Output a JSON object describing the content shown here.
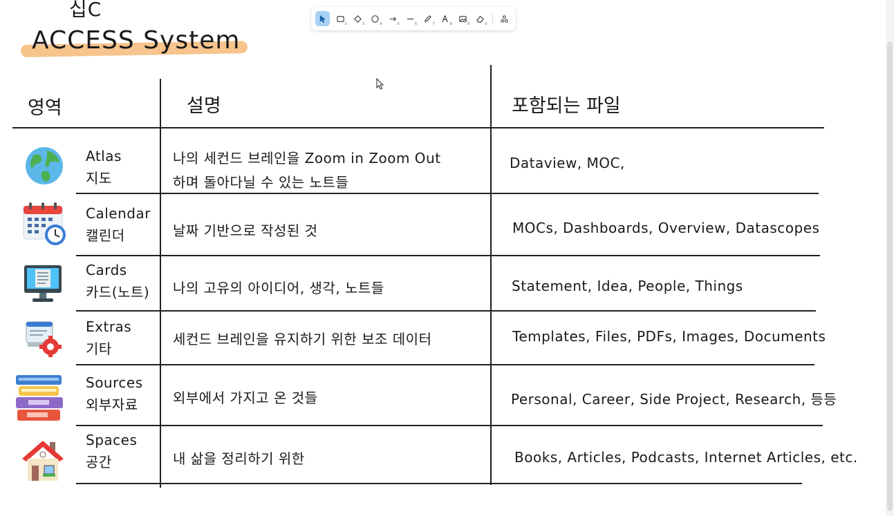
{
  "title": {
    "top": "십C",
    "main": "ACCESS System"
  },
  "toolbar": {
    "tools": [
      {
        "name": "select-tool",
        "num": ""
      },
      {
        "name": "rectangle-tool",
        "num": "2"
      },
      {
        "name": "diamond-tool",
        "num": "3"
      },
      {
        "name": "ellipse-tool",
        "num": "4"
      },
      {
        "name": "arrow-tool",
        "num": "5"
      },
      {
        "name": "line-tool",
        "num": "6"
      },
      {
        "name": "pencil-tool",
        "num": "7"
      },
      {
        "name": "text-tool",
        "num": "8"
      },
      {
        "name": "image-tool",
        "num": "9"
      },
      {
        "name": "eraser-tool",
        "num": "0"
      },
      {
        "name": "more-tools",
        "num": ""
      }
    ]
  },
  "table": {
    "headers": {
      "area": "영역",
      "description": "설명",
      "files": "포함되는 파일"
    },
    "rows": [
      {
        "icon": "globe-icon",
        "name_en": "Atlas",
        "name_ko": "지도",
        "desc_1": "나의 세컨드 브레인을 Zoom in Zoom Out",
        "desc_2": "하며 돌아다닐 수 있는 노트들",
        "files": "Dataview, MOC,"
      },
      {
        "icon": "calendar-icon",
        "name_en": "Calendar",
        "name_ko": "캘린더",
        "desc_1": "날짜 기반으로 작성된 것",
        "desc_2": "",
        "files": "MOCs, Dashboards, Overview, Datascopes"
      },
      {
        "icon": "computer-icon",
        "name_en": "Cards",
        "name_ko": "카드(노트)",
        "desc_1": "나의 고유의 아이디어, 생각, 노트들",
        "desc_2": "",
        "files": "Statement, Idea, People, Things"
      },
      {
        "icon": "settings-screen-icon",
        "name_en": "Extras",
        "name_ko": "기타",
        "desc_1": "세컨드 브레인을 유지하기 위한 보조 데이터",
        "desc_2": "",
        "files": "Templates, Files, PDFs, Images, Documents"
      },
      {
        "icon": "books-icon",
        "name_en": "Sources",
        "name_ko": "외부자료",
        "desc_1": "외부에서 가지고 온 것들",
        "desc_2": "",
        "files": "Personal, Career, Side Project, Research, 등등"
      },
      {
        "icon": "house-icon",
        "name_en": "Spaces",
        "name_ko": "공간",
        "desc_1": "내 삶을 정리하기 위한",
        "desc_2": "",
        "files": "Books, Articles, Podcasts, Internet Articles, etc."
      }
    ]
  },
  "colors": {
    "highlight": "#f6c48c",
    "toolbar_active": "#a8d2f5"
  }
}
